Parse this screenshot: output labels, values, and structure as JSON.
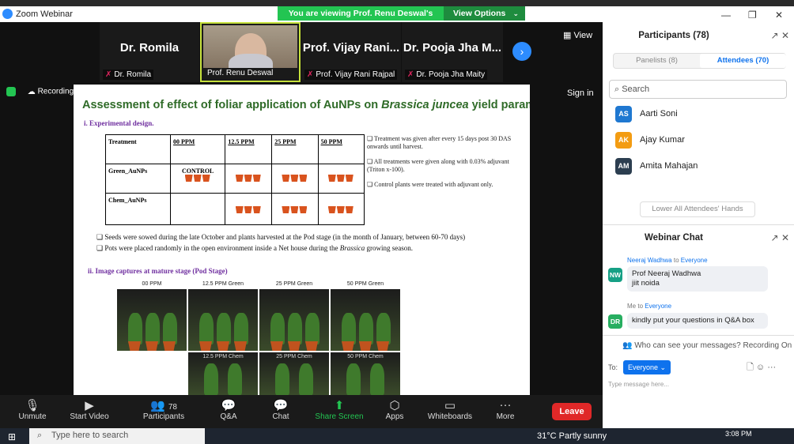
{
  "app_title": "Zoom Webinar",
  "banner": {
    "viewing": "You are viewing Prof. Renu Deswal's screen",
    "view_options": "View Options"
  },
  "video_tiles": [
    {
      "name": "Dr. Romila",
      "label": "Dr. Romila"
    },
    {
      "name": "",
      "label": "Prof. Renu Deswal"
    },
    {
      "name": "Prof. Vijay Rani...",
      "label": "Prof. Vijay Rani Rajpal"
    },
    {
      "name": "Dr. Pooja Jha M...",
      "label": "Dr. Pooja Jha Maity"
    }
  ],
  "view_button": "View",
  "recording": "Recording...",
  "sign_in": "Sign in",
  "slide": {
    "title_pre": "Assessment of effect of foliar application of AuNPs on ",
    "title_italic": "Brassica juncea",
    "title_post": " yield parameters.",
    "section1": "i.    Experimental design.",
    "table_header": [
      "Treatment",
      "00 PPM",
      "12.5 PPM",
      "25 PPM",
      "50 PPM"
    ],
    "row1_label": "Green_AuNPs",
    "control": "CONTROL",
    "row2_label": "Chem_AuNPs",
    "bullets_right": [
      "❏ Treatment was given after every 15 days post 30 DAS onwards until harvest.",
      "❏ All treatments were given along with 0.03% adjuvant (Triton x-100).",
      "❏ Control plants were treated with adjuvant only."
    ],
    "bullet_seeds": "❏  Seeds were sowed during the late October and plants harvested at the Pod stage (in the month of January, between 60-70 days)",
    "bullet_pots_pre": "❏  Pots were placed randomly in the open environment inside a Net house during the ",
    "bullet_pots_italic": "Brassica",
    "bullet_pots_post": " growing season.",
    "section2": "ii.    Image captures at mature stage (Pod Stage)",
    "photo_labels": [
      "00 PPM",
      "12.5 PPM Green",
      "25 PPM Green",
      "50 PPM Green"
    ],
    "photo_captions_chem": [
      "12.5 PPM Chem",
      "25 PPM Chem",
      "50 PPM Chem"
    ]
  },
  "toolbar": {
    "unmute": "Unmute",
    "start_video": "Start Video",
    "participants": "Participants",
    "participants_count": "78",
    "qa": "Q&A",
    "chat": "Chat",
    "share_screen": "Share Screen",
    "apps": "Apps",
    "whiteboards": "Whiteboards",
    "more": "More",
    "leave": "Leave"
  },
  "participants_panel": {
    "title": "Participants (78)",
    "tab_panelists": "Panelists (8)",
    "tab_attendees": "Attendees (70)",
    "search_placeholder": "Search",
    "attendees": [
      {
        "initials": "AS",
        "name": "Aarti Soni",
        "color": "#1f78d1"
      },
      {
        "initials": "AK",
        "name": "Ajay Kumar",
        "color": "#f39c12"
      },
      {
        "initials": "AM",
        "name": "Amita Mahajan",
        "color": "#2c3e50"
      }
    ],
    "lower_hands": "Lower All Attendees' Hands"
  },
  "chat_panel": {
    "title": "Webinar Chat",
    "messages": [
      {
        "sender": "Neeraj Wadhwa",
        "to": "to",
        "recipient": "Everyone",
        "initials": "NW",
        "color": "#16a085",
        "line1": "Prof Neeraj Wadhwa",
        "line2": "jiit noida"
      },
      {
        "sender": "Me",
        "to": "to",
        "recipient": "Everyone",
        "initials": "DR",
        "color": "#27ae60",
        "line1": "kindly put your questions in Q&A box",
        "line2": ""
      }
    ],
    "who_can_see": "Who can see your messages? Recording On",
    "to_label": "To:",
    "to_value": "Everyone",
    "type_placeholder": "Type message here..."
  },
  "taskbar": {
    "search_placeholder": "Type here to search",
    "weather": "31°C  Partly sunny",
    "time": "3:08 PM"
  }
}
